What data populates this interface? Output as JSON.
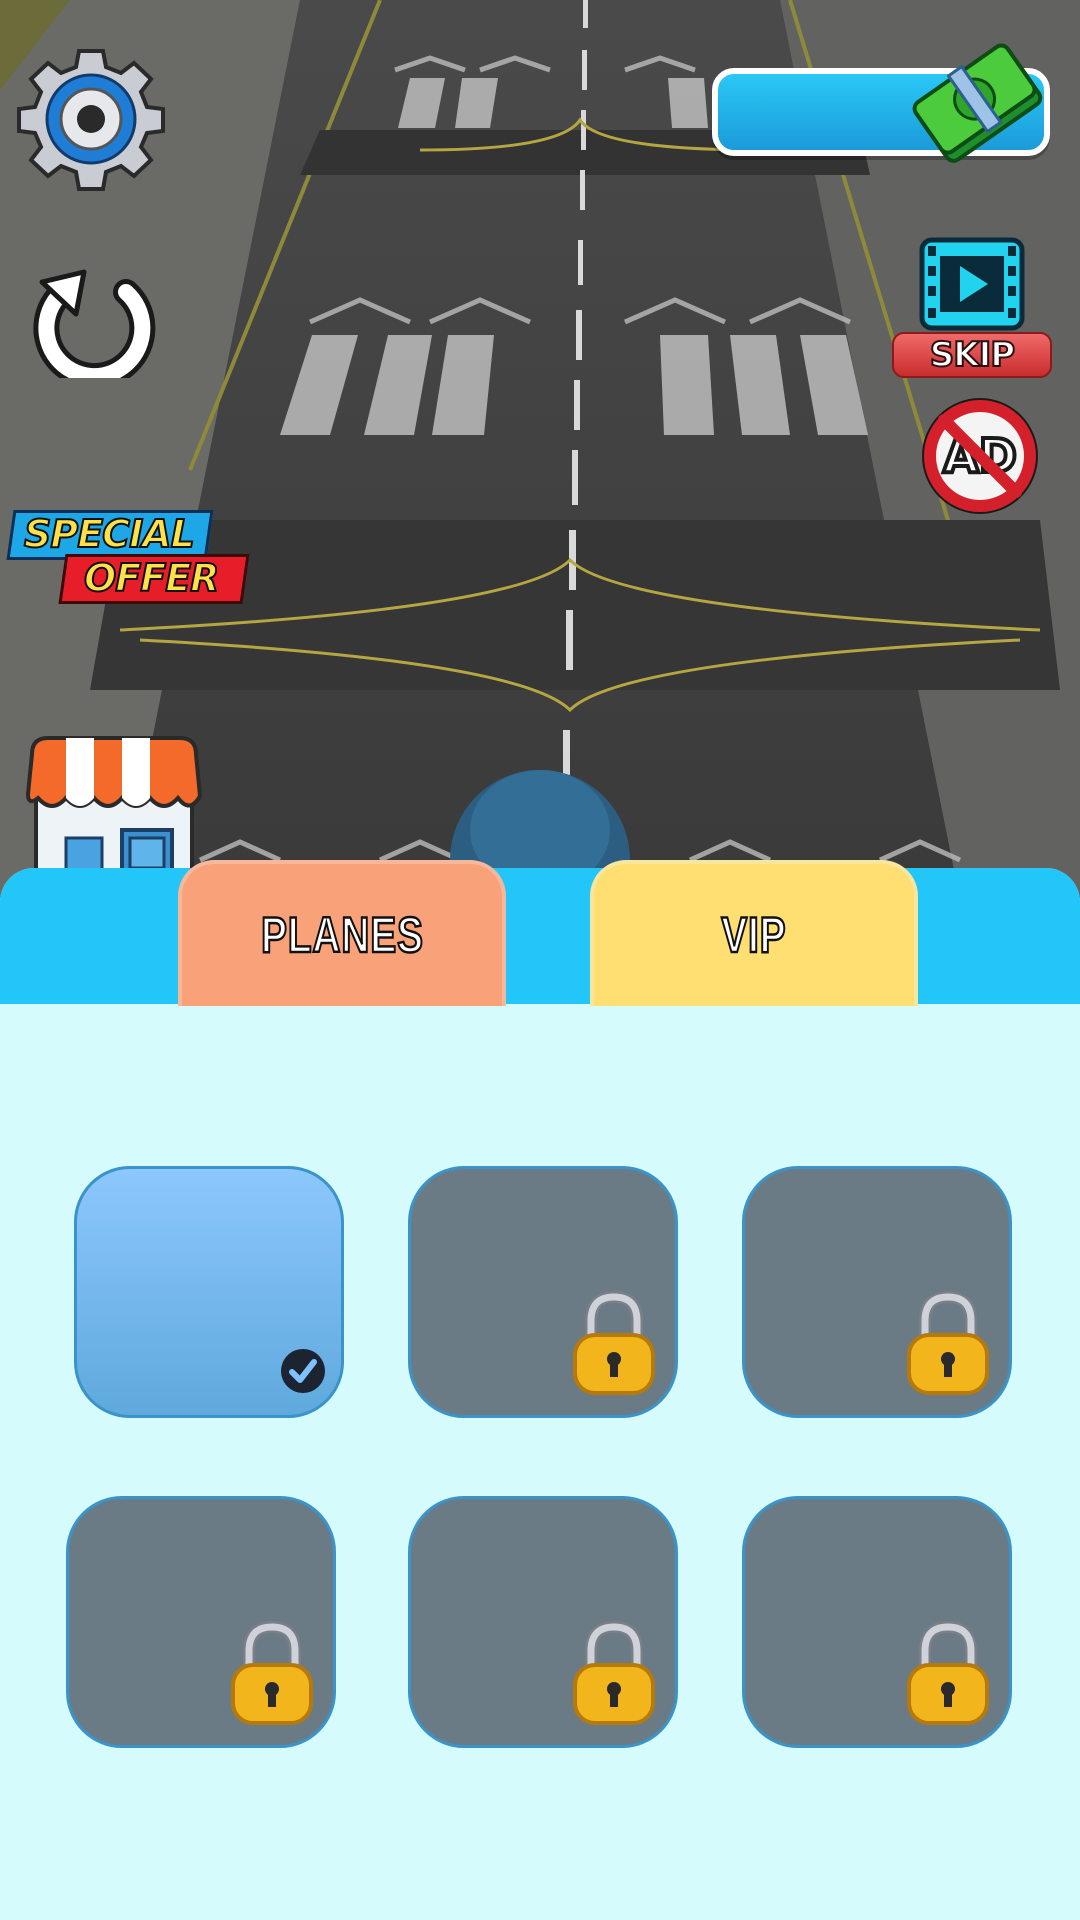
{
  "hud": {
    "money_amount": "",
    "skip_label": "SKIP",
    "special_offer_line1": "SPECIAL",
    "special_offer_line2": "OFFER"
  },
  "tabs": [
    {
      "label": "PLANES",
      "active": true
    },
    {
      "label": "VIP",
      "active": false
    }
  ],
  "slots": [
    {
      "state": "selected"
    },
    {
      "state": "locked"
    },
    {
      "state": "locked"
    },
    {
      "state": "locked"
    },
    {
      "state": "locked"
    },
    {
      "state": "locked"
    }
  ],
  "colors": {
    "panel_bg": "#d6fbfd",
    "header_bg": "#22c6f8",
    "tab_planes": "#f9a27a",
    "tab_vip": "#ffde72",
    "slot_locked": "#6b7b86",
    "slot_selected": "#8cc7fd"
  },
  "icons": [
    "gear-icon",
    "restart-icon",
    "cash-icon",
    "video-skip-icon",
    "no-ads-icon",
    "shop-icon",
    "lock-icon",
    "check-icon"
  ]
}
